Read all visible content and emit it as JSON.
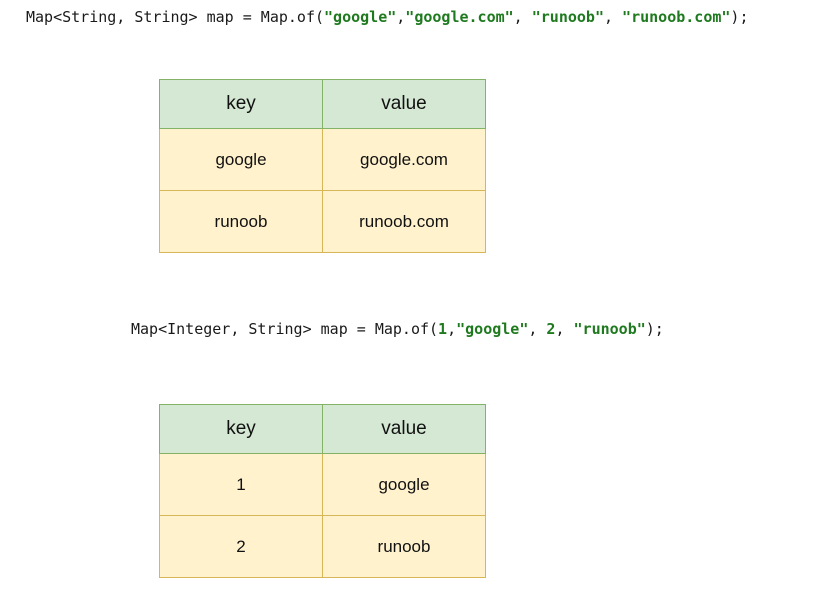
{
  "code1": {
    "prefix": "Map<String, String> map = Map.of(",
    "q1": "\"google\"",
    "c1": ",",
    "q2": "\"google.com\"",
    "c2": ", ",
    "q3": "\"runoob\"",
    "c3": ", ",
    "q4": "\"runoob.com\"",
    "suffix": ");"
  },
  "code2": {
    "prefix": "Map<Integer, String> map = Map.of(",
    "n1": "1",
    "c1": ",",
    "q1": "\"google\"",
    "c2": ", ",
    "n2": "2",
    "c3": ", ",
    "q2": "\"runoob\"",
    "suffix": ");"
  },
  "table1": {
    "headers": [
      "key",
      "value"
    ],
    "rows": [
      [
        "google",
        "google.com"
      ],
      [
        "runoob",
        "runoob.com"
      ]
    ]
  },
  "table2": {
    "headers": [
      "key",
      "value"
    ],
    "rows": [
      [
        "1",
        "google"
      ],
      [
        "2",
        "runoob"
      ]
    ]
  },
  "colors": {
    "header_fill": "#d5e8d4",
    "header_border": "#82b366",
    "cell_fill": "#fff2cc",
    "cell_border": "#d6b656",
    "string_literal": "#1f7a1f"
  }
}
